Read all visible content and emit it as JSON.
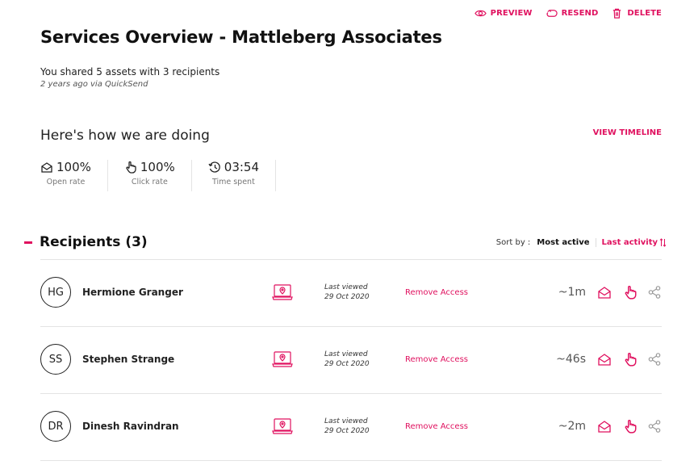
{
  "actions": {
    "preview": "PREVIEW",
    "resend": "RESEND",
    "delete": "DELETE"
  },
  "header": {
    "title": "Services Overview - Mattleberg Associates",
    "shared": "You shared 5 assets with 3 recipients",
    "ago": "2 years ago via QuickSend"
  },
  "performance": {
    "heading": "Here's how we are doing",
    "view_timeline": "VIEW TIMELINE",
    "stats": [
      {
        "value": "100%",
        "label": "Open rate",
        "icon": "envelope-open-icon"
      },
      {
        "value": "100%",
        "label": "Click rate",
        "icon": "pointer-hand-icon"
      },
      {
        "value": "03:54",
        "label": "Time spent",
        "icon": "history-clock-icon"
      }
    ]
  },
  "recipients": {
    "title": "Recipients (3)",
    "sort_label": "Sort by :",
    "sort_most": "Most active",
    "sort_last": "Last activity",
    "list": [
      {
        "initials": "HG",
        "name": "Hermione Granger",
        "last_viewed_label": "Last viewed",
        "last_viewed_date": "29 Oct 2020",
        "remove": "Remove Access",
        "time": "~1m"
      },
      {
        "initials": "SS",
        "name": "Stephen Strange",
        "last_viewed_label": "Last viewed",
        "last_viewed_date": "29 Oct 2020",
        "remove": "Remove Access",
        "time": "~46s"
      },
      {
        "initials": "DR",
        "name": "Dinesh Ravindran",
        "last_viewed_label": "Last viewed",
        "last_viewed_date": "29 Oct 2020",
        "remove": "Remove Access",
        "time": "~2m"
      }
    ]
  },
  "colors": {
    "accent": "#e0115f",
    "text": "#1c1c1c",
    "divider": "#e4e4e4"
  }
}
